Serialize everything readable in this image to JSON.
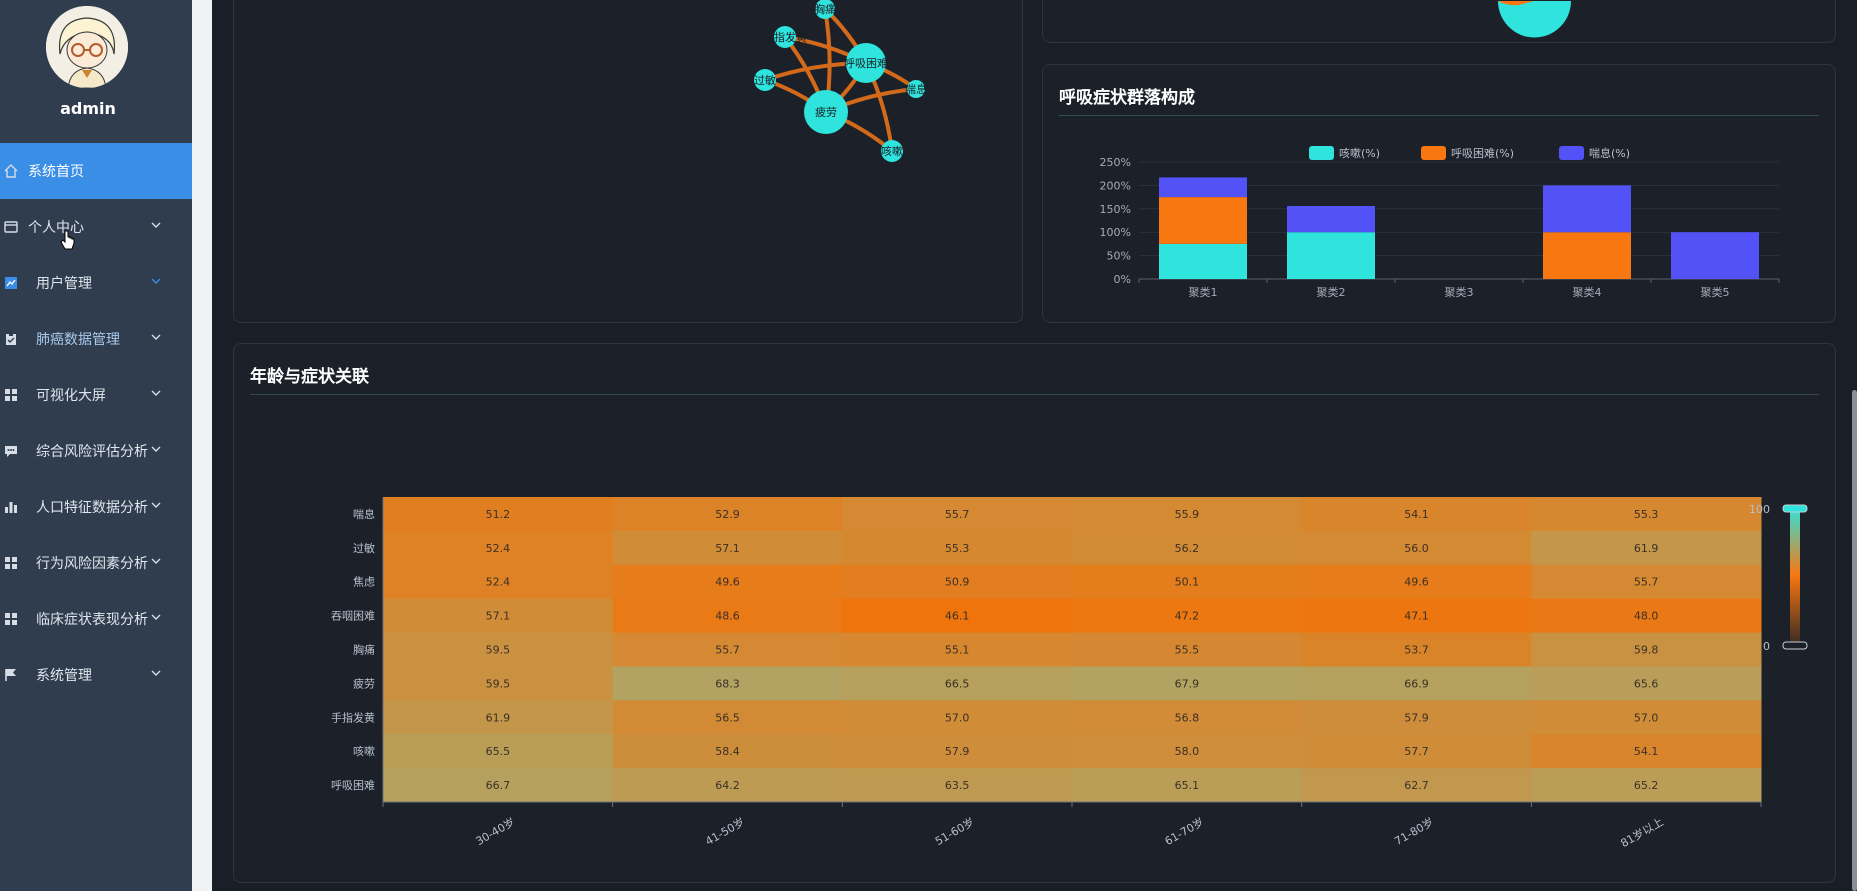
{
  "user": {
    "name": "admin"
  },
  "menu": [
    {
      "label": "系统首页",
      "icon": "home-icon",
      "active": true,
      "has_children": false
    },
    {
      "label": "个人中心",
      "icon": "wallet-icon",
      "active": false,
      "has_children": true
    },
    {
      "label": "用户管理",
      "icon": "chart-icon",
      "active": false,
      "has_children": true
    },
    {
      "label": "肺癌数据管理",
      "icon": "clipboard-icon",
      "active": false,
      "has_children": true
    },
    {
      "label": "可视化大屏",
      "icon": "grid-icon",
      "active": false,
      "has_children": true
    },
    {
      "label": "综合风险评估分析",
      "icon": "comment-icon",
      "active": false,
      "has_children": true
    },
    {
      "label": "人口特征数据分析",
      "icon": "bar-icon",
      "active": false,
      "has_children": true
    },
    {
      "label": "行为风险因素分析",
      "icon": "grid-icon",
      "active": false,
      "has_children": true
    },
    {
      "label": "临床症状表现分析",
      "icon": "grid-icon",
      "active": false,
      "has_children": true
    },
    {
      "label": "系统管理",
      "icon": "flag-icon",
      "active": false,
      "has_children": true
    }
  ],
  "network": {
    "nodes": [
      "胸痛",
      "手指发黄",
      "呼吸困难",
      "过敏",
      "喘息",
      "疲劳",
      "咳嗽"
    ],
    "node_sizes": [
      10,
      11,
      20,
      11,
      9,
      22,
      11
    ],
    "edges": [
      [
        "胸痛",
        "疲劳"
      ],
      [
        "胸痛",
        "呼吸困难"
      ],
      [
        "手指发黄",
        "疲劳"
      ],
      [
        "手指发黄",
        "呼吸困难"
      ],
      [
        "过敏",
        "疲劳"
      ],
      [
        "过敏",
        "呼吸困难"
      ],
      [
        "呼吸困难",
        "疲劳"
      ],
      [
        "呼吸困难",
        "喘息"
      ],
      [
        "呼吸困难",
        "咳嗽"
      ],
      [
        "疲劳",
        "咳嗽"
      ],
      [
        "疲劳",
        "喘息"
      ]
    ],
    "node_color": "#2ee4dc",
    "edge_color": "#d36a1b"
  },
  "cluster_panel": {
    "title": "呼吸症状群落构成",
    "chart_data": {
      "type": "bar",
      "stacked": true,
      "categories": [
        "聚类1",
        "聚类2",
        "聚类3",
        "聚类4",
        "聚类5"
      ],
      "series": [
        {
          "name": "咳嗽(%)",
          "color": "#2ee4dc",
          "values": [
            75,
            100,
            0,
            0,
            0
          ]
        },
        {
          "name": "呼吸困难(%)",
          "color": "#f87711",
          "values": [
            100,
            0,
            0,
            100,
            0
          ]
        },
        {
          "name": "喘息(%)",
          "color": "#5252f7",
          "values": [
            42,
            56,
            0,
            100,
            100
          ]
        }
      ],
      "ylim": [
        0,
        250
      ],
      "yticks": [
        "0%",
        "50%",
        "100%",
        "150%",
        "200%",
        "250%"
      ],
      "legend_position": "top"
    }
  },
  "heatmap_panel": {
    "title": "年龄与症状关联",
    "chart_data": {
      "type": "heatmap",
      "x": [
        "30-40岁",
        "41-50岁",
        "51-60岁",
        "61-70岁",
        "71-80岁",
        "81岁以上"
      ],
      "y": [
        "喘息",
        "过敏",
        "焦虑",
        "吞咽困难",
        "胸痛",
        "疲劳",
        "手指发黄",
        "咳嗽",
        "呼吸困难"
      ],
      "values": [
        [
          51.2,
          52.9,
          55.7,
          55.9,
          54.1,
          55.3
        ],
        [
          52.4,
          57.1,
          55.3,
          56.2,
          56.0,
          61.9
        ],
        [
          52.4,
          49.6,
          50.9,
          50.1,
          49.6,
          55.7
        ],
        [
          57.1,
          48.6,
          46.1,
          47.2,
          47.1,
          48.0
        ],
        [
          59.5,
          55.7,
          55.1,
          55.5,
          53.7,
          59.8
        ],
        [
          59.5,
          68.3,
          66.5,
          67.9,
          66.9,
          65.6
        ],
        [
          61.9,
          56.5,
          57.0,
          56.8,
          57.9,
          57.0
        ],
        [
          65.5,
          58.4,
          57.9,
          58.0,
          57.7,
          54.1
        ],
        [
          66.7,
          64.2,
          63.5,
          65.1,
          62.7,
          65.2
        ]
      ],
      "visual_map": {
        "min": 0,
        "max": 100,
        "max_label": "100",
        "min_label": "0"
      }
    }
  }
}
